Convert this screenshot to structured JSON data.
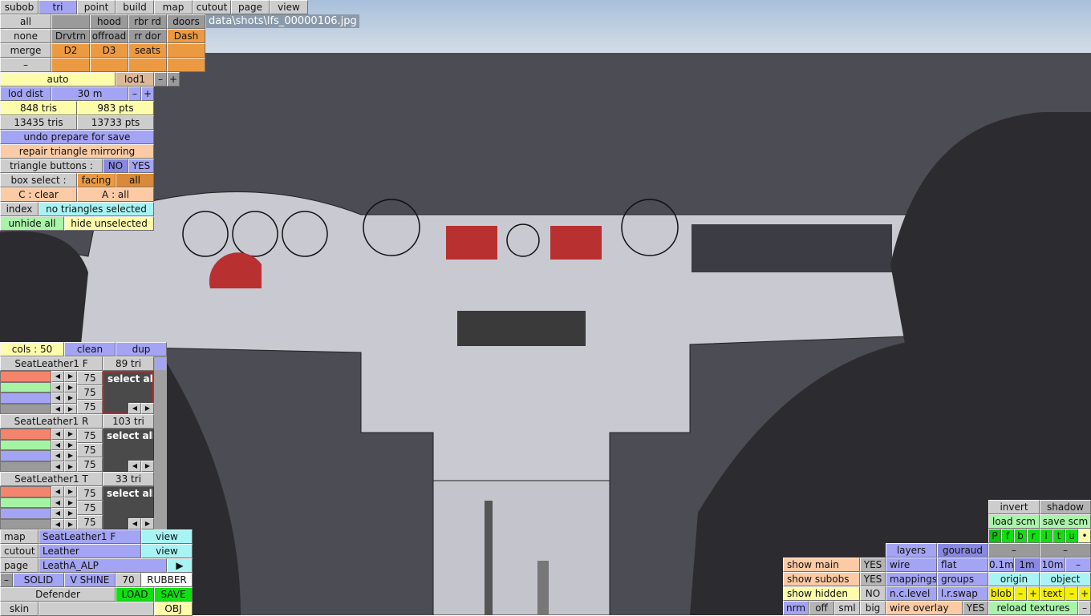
{
  "viewport": {
    "filename": "data\\shots\\lfs_00000106.jpg"
  },
  "tabs": [
    "subob",
    "tri",
    "point",
    "build",
    "map",
    "cutout",
    "page",
    "view"
  ],
  "subobs": {
    "row1": [
      "all",
      "",
      "hood",
      "rbr rd",
      "doors"
    ],
    "row2": [
      "none",
      "Drvtrn",
      "offroad",
      "rr dor",
      "Dash"
    ],
    "row3": [
      "merge",
      "D2",
      "D3",
      "seats",
      ""
    ],
    "row4": [
      "–",
      "",
      "",
      "",
      ""
    ]
  },
  "lod": {
    "auto": "auto",
    "level": "lod1",
    "minus": "–",
    "plus": "+",
    "dist_label": "lod dist",
    "dist_value": "30 m"
  },
  "stats": {
    "sel_tris": "848 tris",
    "sel_pts": "983 pts",
    "total_tris": "13435 tris",
    "total_pts": "13733 pts"
  },
  "actions": {
    "undo": "undo prepare for save",
    "repair": "repair triangle mirroring",
    "tri_buttons": "triangle buttons :",
    "no": "NO",
    "yes": "YES",
    "box_select": "box select :",
    "facing": "facing",
    "all": "all",
    "clear": "C : clear",
    "select_all_key": "A : all",
    "index": "index",
    "status": "no triangles selected",
    "unhide": "unhide all",
    "hide_unsel": "hide unselected"
  },
  "materials": {
    "cols": "cols : 50",
    "clean": "clean",
    "dup": "dup",
    "select_all": "select all",
    "items": [
      {
        "name": "SeatLeather1 F",
        "tris": "89 tri",
        "values": [
          "75",
          "75",
          "75"
        ]
      },
      {
        "name": "SeatLeather1 R",
        "tris": "103 tri",
        "values": [
          "75",
          "75",
          "75"
        ]
      },
      {
        "name": "SeatLeather1 T",
        "tris": "33 tri",
        "values": [
          "75",
          "75",
          "75"
        ]
      }
    ]
  },
  "props": {
    "map": "map",
    "map_val": "SeatLeather1 F",
    "view": "view",
    "cutout": "cutout",
    "cutout_val": "Leather",
    "page": "page",
    "page_val": "LeathA_ALP",
    "arrow": "▶",
    "minus": "–",
    "solid": "SOLID",
    "shine": "V SHINE",
    "shine_val": "70",
    "rubber": "RUBBER",
    "car": "Defender",
    "load": "LOAD",
    "save": "SAVE",
    "skin": "skin",
    "obj": "OBJ"
  },
  "render": {
    "invert": "invert",
    "shadow": "shadow",
    "load_scm": "load scm",
    "save_scm": "save scm",
    "views": [
      "P",
      "f",
      "b",
      "r",
      "l",
      "t",
      "u",
      "•"
    ],
    "layers": "layers",
    "gouraud": "gouraud",
    "dash": "–",
    "show_main": "show main",
    "show_subobs": "show subobs",
    "show_hidden": "show hidden",
    "yes": "YES",
    "no": "NO",
    "wire": "wire",
    "flat": "flat",
    "mappings": "mappings",
    "groups": "groups",
    "nclevel": "n.c.level",
    "lrswap": "l.r.swap",
    "grid": [
      "0.1m",
      "1m",
      "10m",
      "–"
    ],
    "origin": "origin",
    "object": "object",
    "blob": "blob",
    "text": "text",
    "plus": "+",
    "nrm": "nrm",
    "off": "off",
    "sml": "sml",
    "big": "big",
    "wire_overlay": "wire overlay",
    "reload": "reload textures"
  }
}
